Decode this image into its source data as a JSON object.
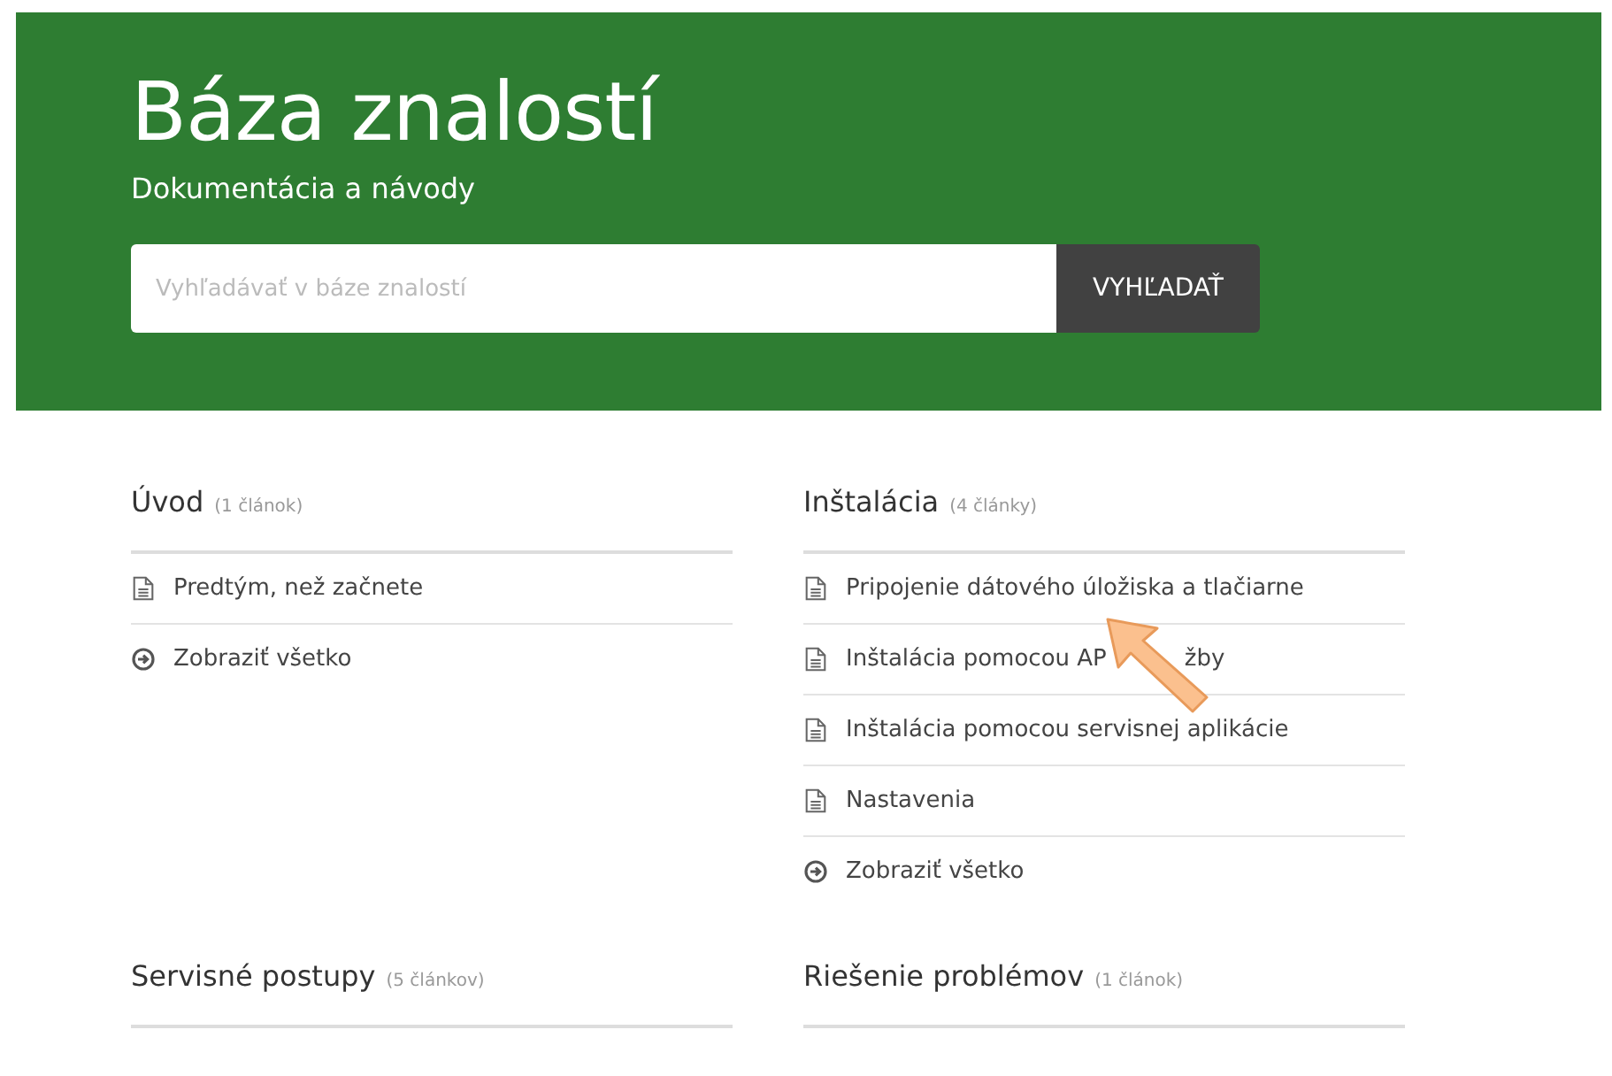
{
  "header": {
    "title": "Báza znalostí",
    "subtitle": "Dokumentácia a návody"
  },
  "search": {
    "placeholder": "Vyhľadávať v báze znalostí",
    "button": "VYHĽADAŤ"
  },
  "categories": [
    {
      "title": "Úvod",
      "count": "(1 článok)",
      "items": [
        {
          "kind": "article",
          "label": "Predtým, než začnete"
        },
        {
          "kind": "more",
          "label": "Zobraziť všetko"
        }
      ]
    },
    {
      "title": "Inštalácia",
      "count": "(4 články)",
      "items": [
        {
          "kind": "article",
          "label": "Pripojenie dátového úložiska a tlačiarne"
        },
        {
          "kind": "article",
          "label": "Inštalácia pomocou AP",
          "label_after": "žby"
        },
        {
          "kind": "article",
          "label": "Inštalácia pomocou servisnej aplikácie"
        },
        {
          "kind": "article",
          "label": "Nastavenia"
        },
        {
          "kind": "more",
          "label": "Zobraziť všetko"
        }
      ]
    },
    {
      "title": "Servisné postupy",
      "count": "(5 článkov)"
    },
    {
      "title": "Riešenie problémov",
      "count": "(1 článok)"
    }
  ]
}
